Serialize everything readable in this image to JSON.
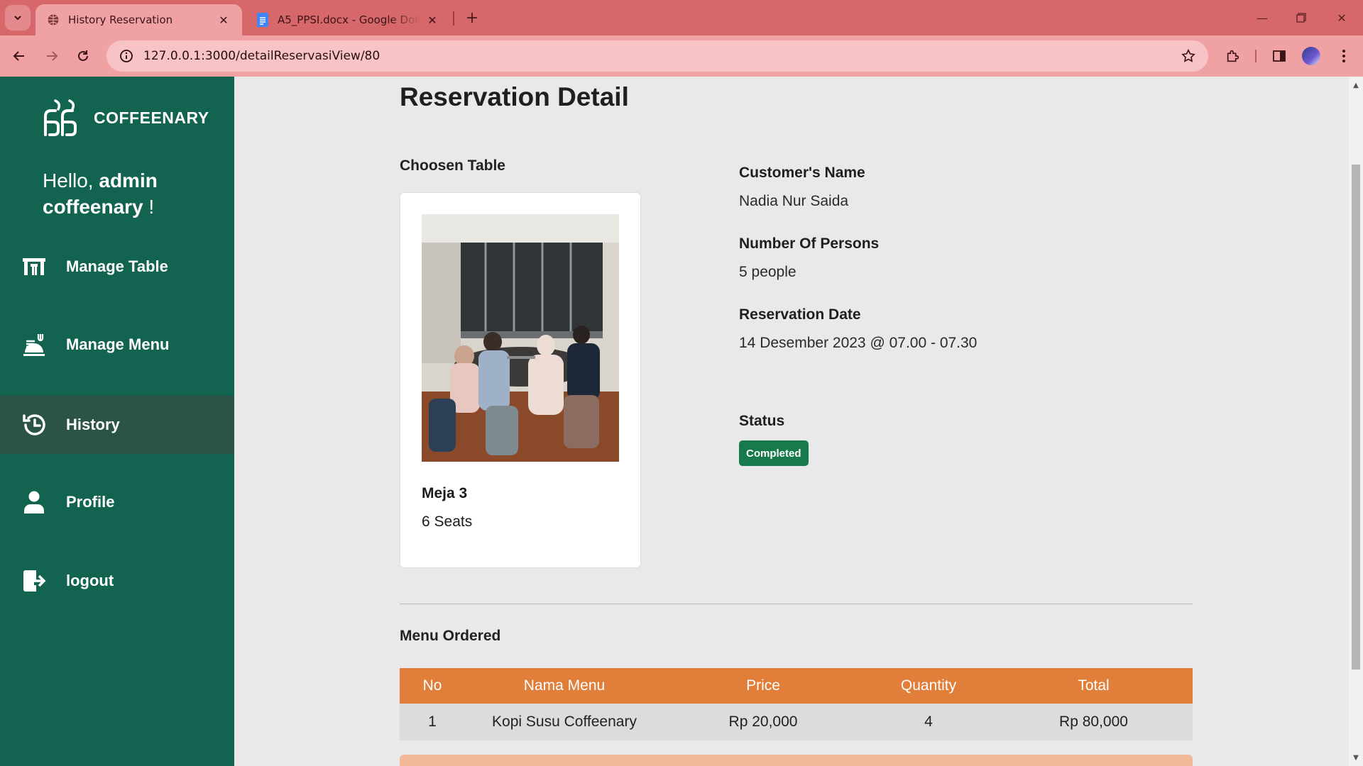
{
  "browser": {
    "tabs": [
      {
        "title": "History Reservation",
        "favicon": "globe-icon",
        "active": true
      },
      {
        "title": "A5_PPSI.docx - Google Dokumen",
        "favicon": "docs-icon",
        "active": false
      }
    ],
    "url": "127.0.0.1:3000/detailReservasiView/80"
  },
  "sidebar": {
    "brand": "COFFEENARY",
    "greeting_prefix": "Hello, ",
    "greeting_user": "admin coffeenary",
    "greeting_suffix": " !",
    "items": [
      {
        "label": "Manage Table",
        "icon": "table-icon"
      },
      {
        "label": "Manage Menu",
        "icon": "food-tray-icon"
      },
      {
        "label": "History",
        "icon": "history-icon",
        "active": true
      },
      {
        "label": "Profile",
        "icon": "user-icon"
      },
      {
        "label": "logout",
        "icon": "logout-icon"
      }
    ]
  },
  "page": {
    "title": "Reservation Detail",
    "chosen_table_label": "Choosen Table",
    "table": {
      "name": "Meja 3",
      "seats": "6 Seats"
    },
    "details": [
      {
        "label": "Customer's Name",
        "value": "Nadia Nur Saida"
      },
      {
        "label": "Number Of Persons",
        "value": "5 people"
      },
      {
        "label": "Reservation Date",
        "value": "14 Desember 2023 @ 07.00 - 07.30"
      }
    ],
    "status_label": "Status",
    "status_value": "Completed",
    "status_color": "#177a4c",
    "menu_label": "Menu Ordered",
    "menu_table": {
      "headers": [
        "No",
        "Nama Menu",
        "Price",
        "Quantity",
        "Total"
      ],
      "rows": [
        [
          "1",
          "Kopi Susu Coffeenary",
          "Rp 20,000",
          "4",
          "Rp 80,000"
        ]
      ]
    }
  },
  "colors": {
    "sidebar": "#126451",
    "sidebar_active": "#2b5347",
    "table_header": "#e07e3a",
    "browser_frame": "#d6676a"
  }
}
